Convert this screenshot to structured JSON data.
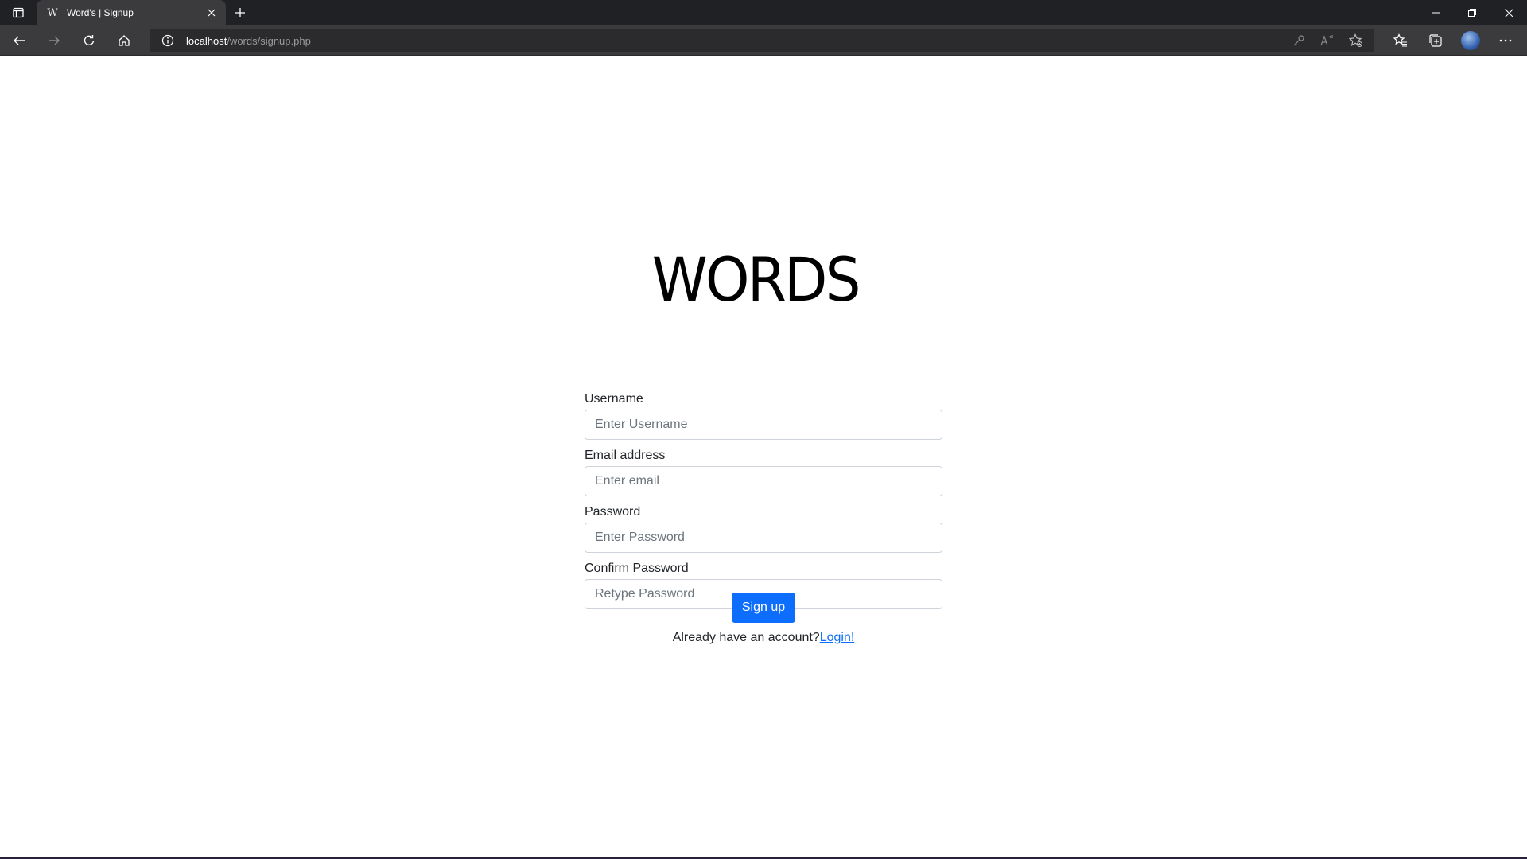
{
  "browser": {
    "tab_title": "Word's | Signup",
    "tab_favicon": "W",
    "url_host": "localhost",
    "url_path": "/words/signup.php",
    "icons": {
      "tab_actions": "tab-actions-icon",
      "tab_close": "close-icon",
      "new_tab": "plus-icon",
      "minimize": "minimize-icon",
      "restore": "restore-icon",
      "close_window": "close-icon",
      "back": "back-arrow-icon",
      "forward": "forward-arrow-icon",
      "refresh": "refresh-icon",
      "home": "home-icon",
      "site_info": "info-icon",
      "key": "key-icon",
      "read_aloud": "read-aloud-icon",
      "add_favorite": "star-plus-icon",
      "favorites": "favorites-list-icon",
      "collections": "collections-icon",
      "profile": "avatar",
      "menu": "more-icon"
    }
  },
  "page": {
    "logo_text": "WORDS",
    "form": {
      "username": {
        "label": "Username",
        "placeholder": "Enter Username"
      },
      "email": {
        "label": "Email address",
        "placeholder": "Enter email"
      },
      "password": {
        "label": "Password",
        "placeholder": "Enter Password"
      },
      "confirm_password": {
        "label": "Confirm Password",
        "placeholder": "Retype Password"
      },
      "submit_label": "Sign up"
    },
    "footer": {
      "prompt": "Already have an account?",
      "login_link": "Login!"
    }
  },
  "colors": {
    "primary": "#0d6efd",
    "titlebar": "#202124",
    "toolbar": "#3b3b3d"
  }
}
